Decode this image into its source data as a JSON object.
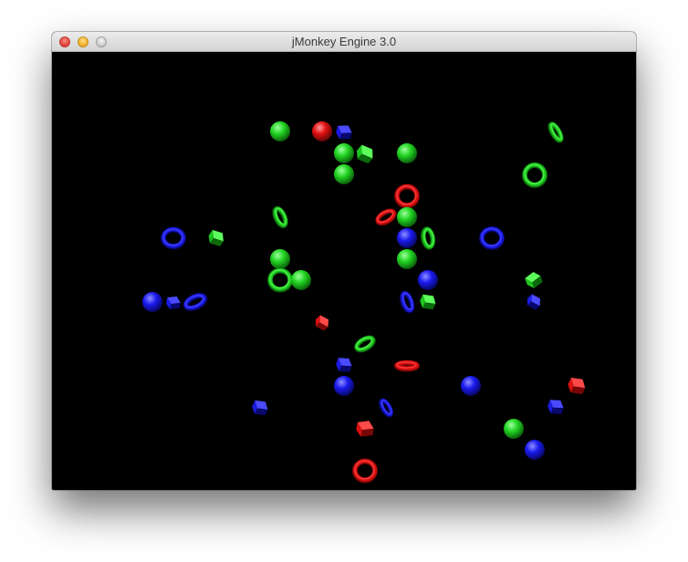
{
  "window": {
    "title": "jMonkey Engine 3.0"
  },
  "colors": {
    "red": "#e01010",
    "green": "#1fd41f",
    "blue": "#1a1aee",
    "background": "#000000"
  },
  "scene": {
    "objects": [
      {
        "shape": "sphere",
        "color": "green"
      },
      {
        "shape": "sphere",
        "color": "red"
      },
      {
        "shape": "cube",
        "color": "blue"
      },
      {
        "shape": "sphere",
        "color": "green"
      },
      {
        "shape": "cube",
        "color": "green"
      },
      {
        "shape": "sphere",
        "color": "green"
      },
      {
        "shape": "sphere",
        "color": "green"
      },
      {
        "shape": "torus",
        "color": "green"
      },
      {
        "shape": "torus",
        "color": "green"
      },
      {
        "shape": "torus",
        "color": "red"
      },
      {
        "shape": "torus",
        "color": "red"
      },
      {
        "shape": "sphere",
        "color": "green"
      },
      {
        "shape": "sphere",
        "color": "blue"
      },
      {
        "shape": "torus",
        "color": "green"
      },
      {
        "shape": "sphere",
        "color": "green"
      },
      {
        "shape": "torus",
        "color": "green"
      },
      {
        "shape": "torus",
        "color": "blue"
      },
      {
        "shape": "cube",
        "color": "green"
      },
      {
        "shape": "torus",
        "color": "blue"
      },
      {
        "shape": "sphere",
        "color": "green"
      },
      {
        "shape": "torus",
        "color": "green"
      },
      {
        "shape": "sphere",
        "color": "green"
      },
      {
        "shape": "sphere",
        "color": "blue"
      },
      {
        "shape": "cube",
        "color": "green"
      },
      {
        "shape": "sphere",
        "color": "blue"
      },
      {
        "shape": "cube",
        "color": "blue"
      },
      {
        "shape": "torus",
        "color": "blue"
      },
      {
        "shape": "torus",
        "color": "blue"
      },
      {
        "shape": "cube",
        "color": "green"
      },
      {
        "shape": "cube",
        "color": "blue"
      },
      {
        "shape": "cube",
        "color": "red"
      },
      {
        "shape": "torus",
        "color": "green"
      },
      {
        "shape": "cube",
        "color": "blue"
      },
      {
        "shape": "torus",
        "color": "red"
      },
      {
        "shape": "sphere",
        "color": "blue"
      },
      {
        "shape": "sphere",
        "color": "blue"
      },
      {
        "shape": "cube",
        "color": "red"
      },
      {
        "shape": "cube",
        "color": "blue"
      },
      {
        "shape": "torus",
        "color": "blue"
      },
      {
        "shape": "sphere",
        "color": "green"
      },
      {
        "shape": "cube",
        "color": "blue"
      },
      {
        "shape": "cube",
        "color": "red"
      },
      {
        "shape": "sphere",
        "color": "blue"
      },
      {
        "shape": "torus",
        "color": "red"
      }
    ]
  }
}
